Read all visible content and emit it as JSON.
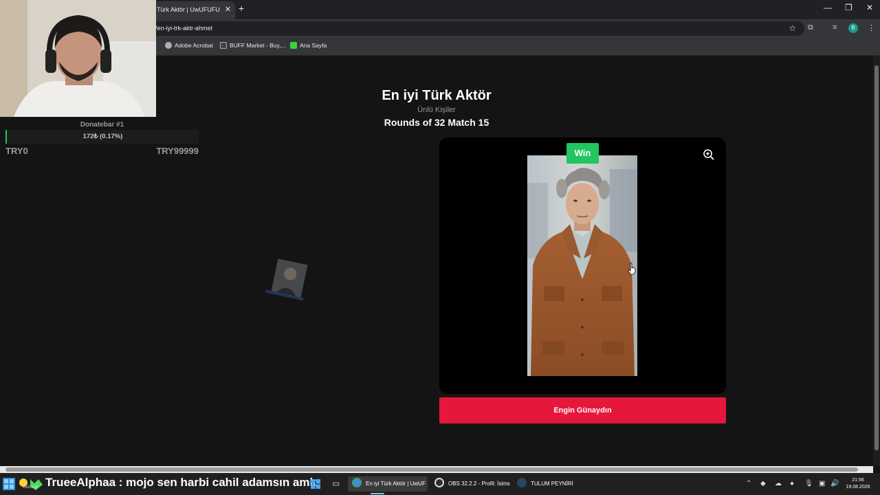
{
  "browser": {
    "tab_title": "Türk Aktör | UwUFUFU",
    "tab_close": "✕",
    "new_tab": "+",
    "url": "/en-iyi-trk-aktr-ahmet",
    "bookmarks": [
      "Adobe Acrobat",
      "BUFF Market - Buy,...",
      "Ana Sayfa"
    ]
  },
  "webcam_overlay": {
    "donate_title": "Donatebar #1",
    "donate_progress_text": "172₺ (0.17%)",
    "donate_progress": 0.17,
    "donate_min": "TRY0",
    "donate_max": "TRY99999"
  },
  "game": {
    "title": "En iyi Türk Aktör",
    "subtitle": "Ünlü Kişiler",
    "round": "Rounds of 32 Match 15",
    "win_badge": "Win",
    "candidate_name": "Engin Günaydın"
  },
  "taskbar": {
    "weather_label": "Güneşli",
    "chat_message": "TrueeAlphaa : mojo sen harbi cahil adamsın amk",
    "tasks": [
      "En iyi Türk Aktör | UwUF",
      "OBS 32.2.2 - Profil: İsims",
      "TULUM PEYNİRİ"
    ],
    "clock_time": "21:56",
    "clock_date": "19.08.2026"
  },
  "colors": {
    "win": "#22c55e",
    "name_button": "#e5173b",
    "page_bg": "#141414",
    "card_bg": "#000000"
  }
}
